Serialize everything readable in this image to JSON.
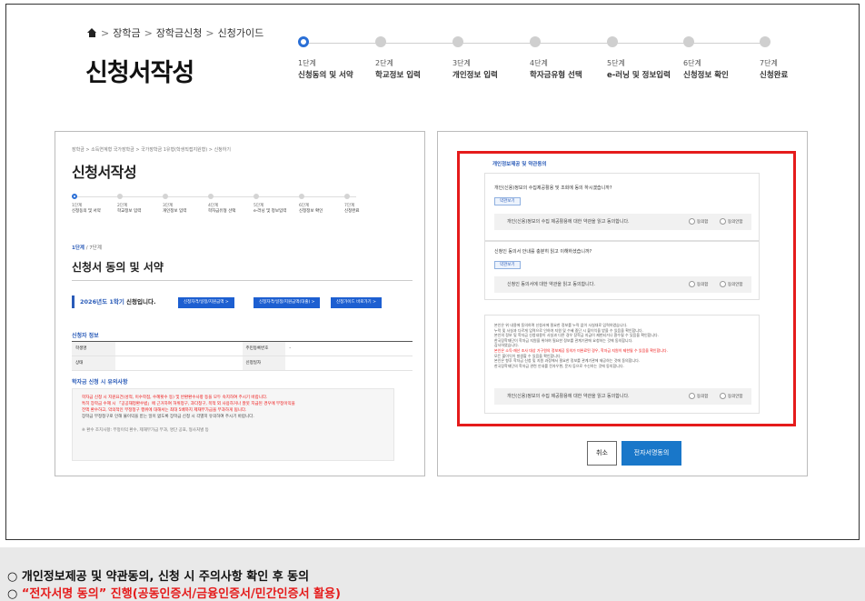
{
  "breadcrumb": [
    "장학금",
    "장학금신청",
    "신청가이드"
  ],
  "page_title": "신청서작성",
  "steps": [
    {
      "num": "1단계",
      "label": "신청동의 및 서약"
    },
    {
      "num": "2단계",
      "label": "학교정보 입력"
    },
    {
      "num": "3단계",
      "label": "개인정보 입력"
    },
    {
      "num": "4단계",
      "label": "학자금유형 선택"
    },
    {
      "num": "5단계",
      "label": "e-러닝 및 정보입력"
    },
    {
      "num": "6단계",
      "label": "신청정보 확인"
    },
    {
      "num": "7단계",
      "label": "신청완료"
    }
  ],
  "active_step": 1,
  "left_panel": {
    "breadcrumb": "장학금 > 소득연계형 국가장학금 > 국가장학금 1유형(학생직접지원형) > 신청하기",
    "title": "신청서작성",
    "step_count": {
      "current": "1단계",
      "total": " / 7단계"
    },
    "section_title": "신청서 동의 및 서약",
    "semester": {
      "year": "2026년도 1학기",
      "suffix": " 신청입니다."
    },
    "buttons": [
      "신청자격/일정/지원금액 >",
      "신청자격/일정/지원금액(대출) >",
      "신청가이드 바로가기 >"
    ],
    "applicant_title": "신청자 정보",
    "table": [
      [
        {
          "label": "학생명",
          "value": ""
        },
        {
          "label": "주민등록번호",
          "value": "-"
        }
      ],
      [
        {
          "label": "상태",
          "value": ""
        },
        {
          "label": "신청일자",
          "value": ""
        }
      ]
    ],
    "notice_title": "학자금 신청 시 유의사항",
    "notice_lines": [
      "학자금 신청 시 지원요건(성적, 이수학점, 수혜횟수 등) 및 반환환수사항 등을 모두 숙지하여 주시기 바랍니다.",
      "특히 장학금 수혜 시 「공공재정환수법」에 근거하여 허위청구, 과다청구, 목적 외 사용하거나 잘못 지급된 경우에 부정이익을",
      "전액 환수하고, 악의적인 부정청구 행위에 대해서는 최대 5배까지 제재부가금을 부과하게 됩니다.",
      "장학금 부정청구로 인해 불이익을 받는 일이 없도록 장학금 신청 시 각별히 유의하여 주시기 바랍니다.",
      "※ 환수 조치사항: 부정이익 환수, 제재부가금 부과, 명단 공표, 형사처벌 등"
    ]
  },
  "right_panel": {
    "header": "개인정보제공 및 약관동의",
    "q1": "개인(신용)정보의 수집제공활용 및 조회에 동의 하시겠습니까?",
    "q1_tag": "약관보기",
    "q1_agree": "개인(신용)정보의 수집 제공활용에 대한 약관을 읽고 동의합니다.",
    "q2": "신청인 동의서 안내를 충분히 읽고 이해하셨습니까?",
    "q2_tag": "약관보기",
    "q2_agree": "신청인 동의서에 대한 약관을 읽고 동의합니다.",
    "info_lines": [
      "본인은 위 내용에 동의하며 신청서에 필요한 정보를 누락 없이 사실대로 입력하였습니다.",
      "누락 및 사실과 다르게 입력으로 인하여 지원 및 수혜 중단 시 불이익을 받을 수 있음을 확인합니다.",
      "본인의 정보 및 학자금 신청내용이 사실과 다른 경우 장학금 지급이 제한되거나 환수될 수 있음을 확인합니다.",
      "한국장학재단이 학자금 지원을 위하여 필요한 정보를 관계기관에 요청하는 것에 동의합니다.",
      "감사하였습니다.",
      "본인은 소득·재산 조사 대상 가구원의 정보제공 동의가 미완료된 경우, 학자금 지원이 제한될 수 있음을 확인합니다.",
      "모든 불이익이 발생할 수 있음을 확인합니다.",
      "본인은 향후 학자금 신청 및 지원 과정에서 필요한 정보를 관계기관에 제공하는 것에 동의합니다.",
      "한국장학재단의 학자금 관련 안내를 전자우편, 문자 등으로 수신하는 것에 동의합니다."
    ],
    "info_agree": "개인(신용)정보의 수집 제공활용에 대한 약관을 읽고 동의합니다.",
    "radio_yes": "동의함",
    "radio_no": "동의안함",
    "cancel": "취소",
    "sign": "전자서명동의"
  },
  "footer": {
    "line1": "○ 개인정보제공 및 약관동의, 신청 시 주의사항 확인 후 동의",
    "line2_prefix": "○ ",
    "line2_em": "“전자서명 동의” 진행(공동인증서/금융인증서/민간인증서 활용)"
  },
  "colors": {
    "accent": "#2a6fd6",
    "highlight_box": "#e51b1b",
    "sign_button": "#1977c9"
  }
}
